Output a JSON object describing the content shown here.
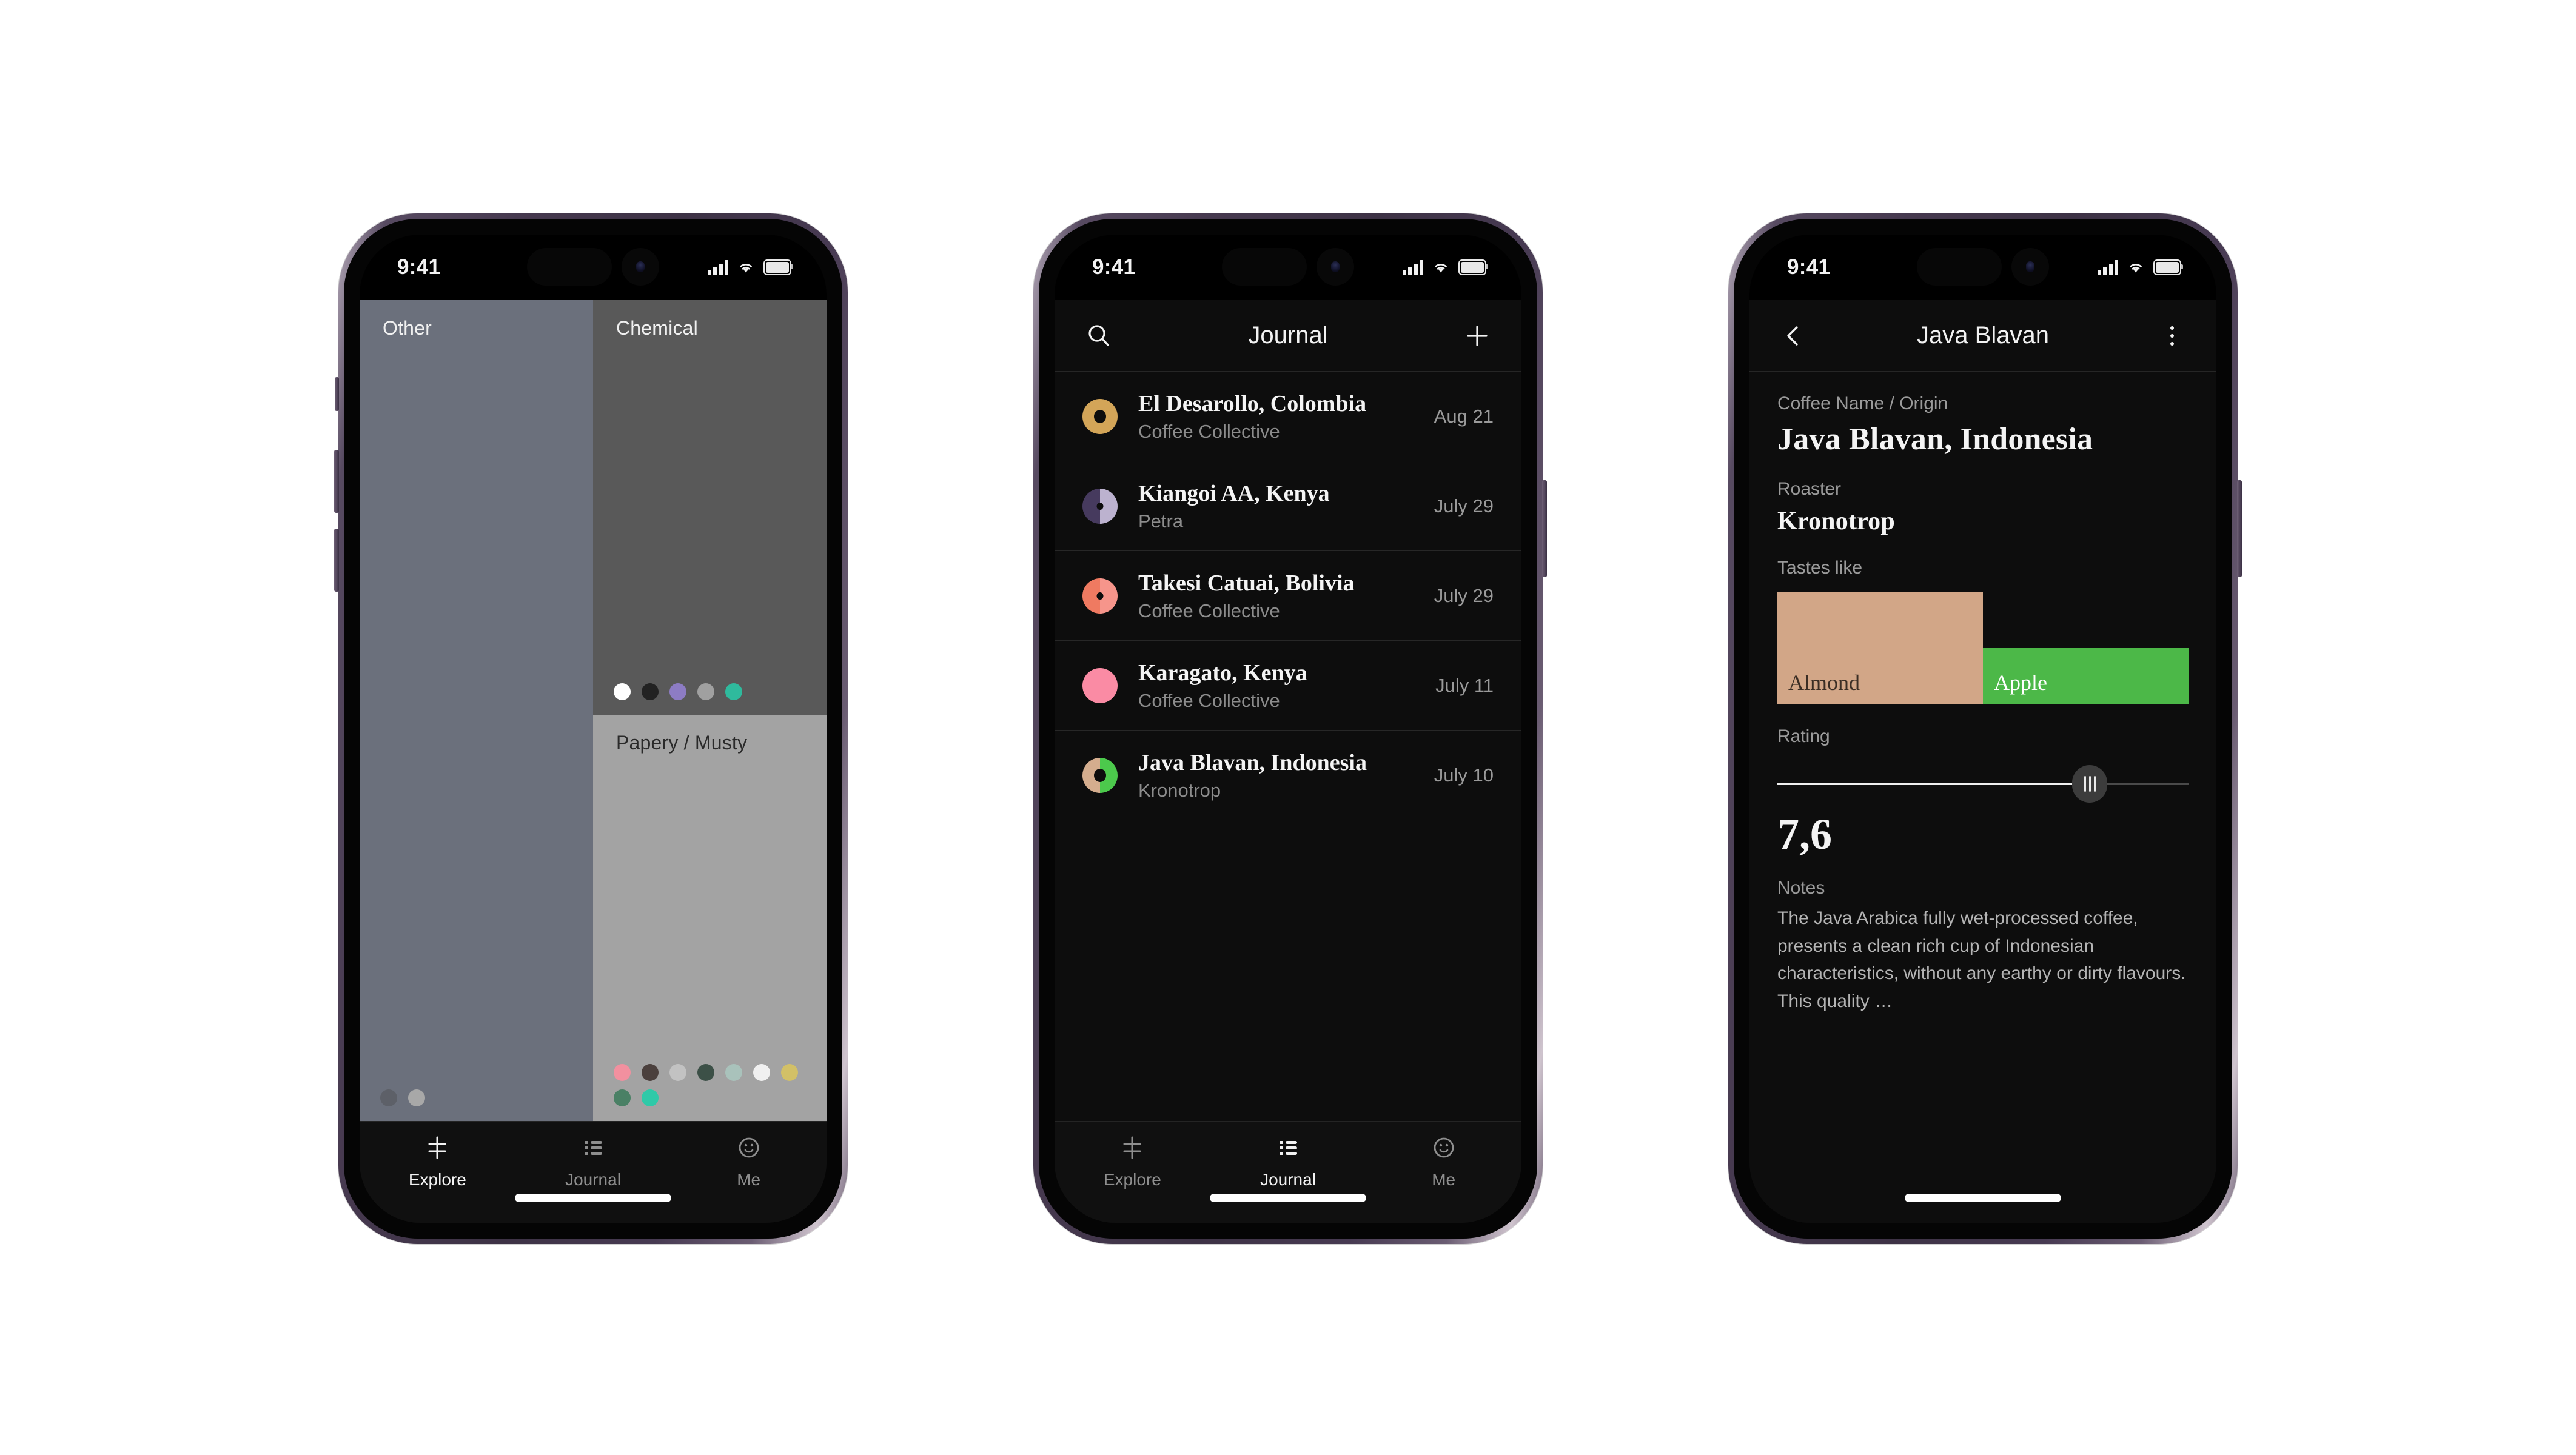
{
  "status_bar": {
    "time": "9:41",
    "icons": [
      "cellular-bars",
      "wifi",
      "battery"
    ]
  },
  "tabs": [
    {
      "name": "explore",
      "label": "Explore",
      "icon": "explore-filter-icon"
    },
    {
      "name": "journal",
      "label": "Journal",
      "icon": "list-icon"
    },
    {
      "name": "me",
      "label": "Me",
      "icon": "smiley-face-icon"
    }
  ],
  "phone1": {
    "active_tab": "Explore",
    "panels": [
      {
        "label": "Other",
        "bg": "#6b707c",
        "label_color": "light",
        "dots": [
          "#5d6068",
          "#a8a8a8"
        ]
      },
      {
        "label": "Chemical",
        "bg": "#595959",
        "label_color": "light",
        "dots": [
          "#ffffff",
          "#222222",
          "#8d7cc4",
          "#a0a0a0",
          "#2fba9d"
        ]
      },
      {
        "label": "Papery / Musty",
        "bg": "#a3a3a3",
        "label_color": "dark",
        "dots": [
          "#f2909f",
          "#4b403d",
          "#c2c2c2",
          "#3c5047",
          "#a9c2bb",
          "#f0f0f0",
          "#d2c067",
          "#4a8065",
          "#2fc9a8"
        ]
      }
    ]
  },
  "phone2": {
    "active_tab": "Journal",
    "nav": {
      "title": "Journal",
      "left_icon": "search-icon",
      "right_icon": "plus-icon"
    },
    "entries": [
      {
        "title": "El Desarollo, Colombia",
        "roaster": "Coffee Collective",
        "date": "Aug 21",
        "avatar": {
          "left": "#d3a558",
          "right": "#d3a558",
          "hole": 20
        }
      },
      {
        "title": "Kiangoi AA, Kenya",
        "roaster": "Petra",
        "date": "July 29",
        "avatar": {
          "left": "#463a5e",
          "right": "#bcb2cf",
          "hole": 10
        }
      },
      {
        "title": "Takesi Catuai, Bolivia",
        "roaster": "Coffee Collective",
        "date": "July 29",
        "avatar": {
          "left": "#ef7a61",
          "right": "#f6958b",
          "hole": 10
        }
      },
      {
        "title": "Karagato, Kenya",
        "roaster": "Coffee Collective",
        "date": "July 11",
        "avatar": {
          "left": "#fa8ba4",
          "right": "#fa8ba4",
          "hole": 0
        }
      },
      {
        "title": "Java Blavan, Indonesia",
        "roaster": "Kronotrop",
        "date": "July 10",
        "avatar": {
          "left": "#d4ad8e",
          "right": "#4bc košík",
          "hole": 20
        }
      }
    ]
  },
  "phone3": {
    "nav": {
      "title": "Java Blavan",
      "left_icon": "back-chevron-icon",
      "right_icon": "more-vertical-icon"
    },
    "fields": {
      "name_label": "Coffee Name / Origin",
      "name_value": "Java Blavan, Indonesia",
      "roaster_label": "Roaster",
      "roaster_value": "Kronotrop",
      "tastes_label": "Tastes like",
      "rating_label": "Rating",
      "rating_value": "7,6",
      "notes_label": "Notes",
      "notes_body": "The Java Arabica fully wet-processed coffee, presents a clean rich cup of Indonesian characteristics, without any earthy or dirty flavours. This quality …"
    },
    "tastes": [
      {
        "label": "Almond",
        "color": "#d2a687",
        "text_color": "#3a2d24",
        "height_pct": 100,
        "width_pct": 50
      },
      {
        "label": "Apple",
        "color": "#4cb848",
        "text_color": "#ffffff",
        "height_pct": 50,
        "width_pct": 50
      }
    ],
    "rating": {
      "value": 7.6,
      "min": 0,
      "max": 10,
      "fill_pct": 76
    }
  },
  "chart_data": {
    "type": "bar",
    "title": "Tastes like",
    "categories": [
      "Almond",
      "Apple"
    ],
    "values": [
      100,
      50
    ],
    "colors": [
      "#d2a687",
      "#4cb848"
    ],
    "ylabel": "",
    "xlabel": "",
    "ylim": [
      0,
      100
    ],
    "grid": false,
    "legend": "none"
  }
}
